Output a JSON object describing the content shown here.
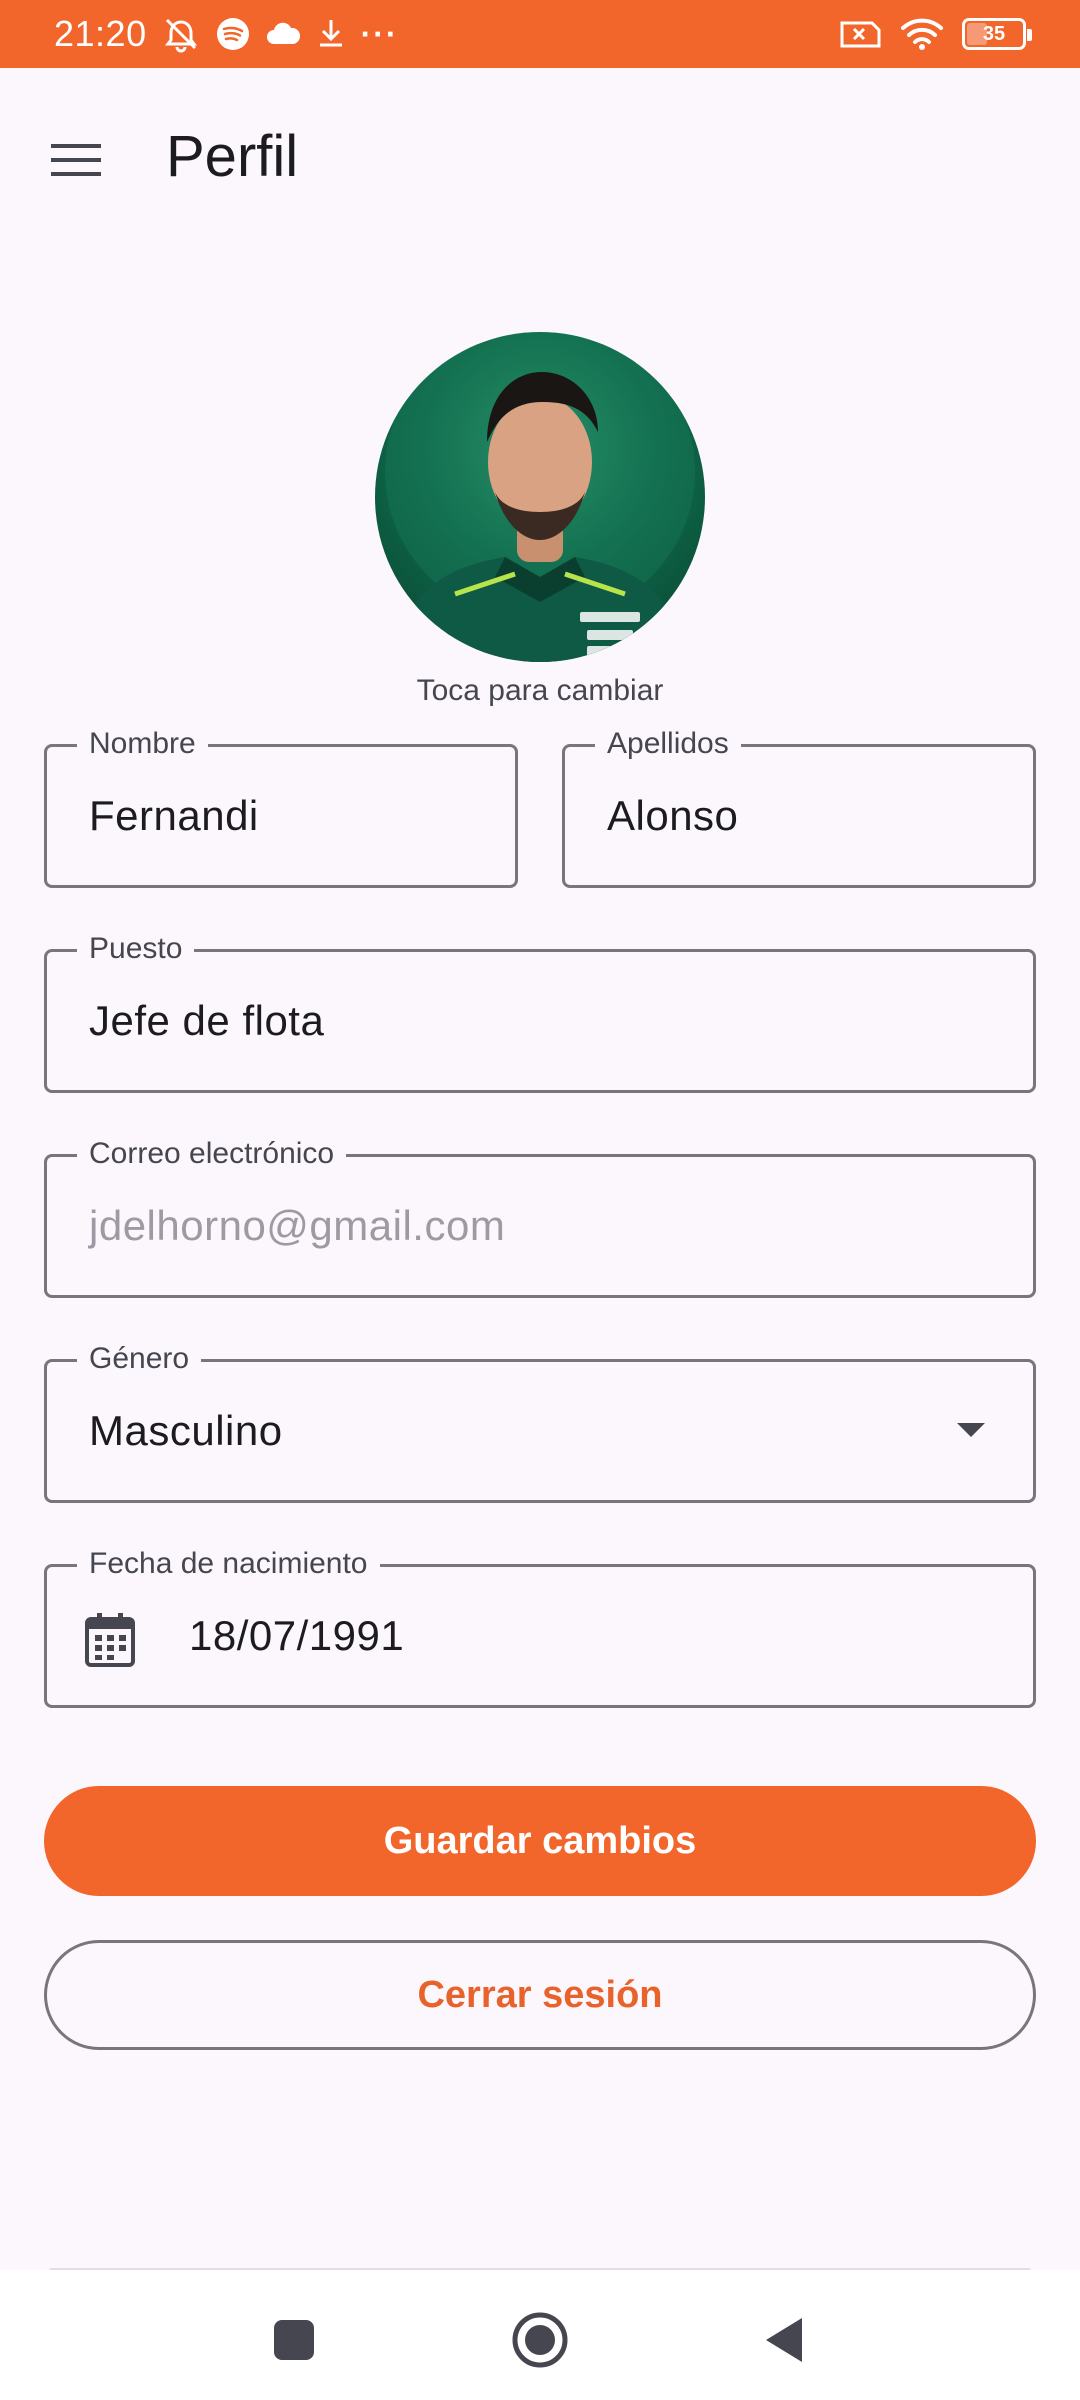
{
  "status_bar": {
    "time": "21:20",
    "overflow": "···",
    "battery": "35",
    "battery_level_percent": 35,
    "left_icons": [
      "alarm-off-icon",
      "spotify-icon",
      "cloud-icon",
      "download-icon",
      "more-icon"
    ],
    "right_icons": [
      "sim-off-icon",
      "wifi-icon",
      "battery-icon"
    ]
  },
  "app_bar": {
    "title": "Perfil",
    "menu_icon": "menu-icon"
  },
  "profile": {
    "avatar_hint": "Toca para cambiar"
  },
  "form": {
    "first_name": {
      "label": "Nombre",
      "value": "Fernandi"
    },
    "last_name": {
      "label": "Apellidos",
      "value": "Alonso"
    },
    "position": {
      "label": "Puesto",
      "value": "Jefe de flota"
    },
    "email": {
      "label": "Correo electrónico",
      "placeholder": "jdelhorno@gmail.com"
    },
    "gender": {
      "label": "Género",
      "value": "Masculino"
    },
    "birth_date": {
      "label": "Fecha de nacimiento",
      "value": "18/07/1991",
      "icon": "calendar-icon"
    }
  },
  "actions": {
    "save_label": "Guardar cambios",
    "logout_label": "Cerrar sesión"
  },
  "colors": {
    "accent": "#f2652b",
    "background": "#fcf7fc",
    "outline": "#79747e"
  },
  "nav_bar": {
    "icons": [
      "recents-icon",
      "home-icon",
      "back-icon"
    ]
  }
}
